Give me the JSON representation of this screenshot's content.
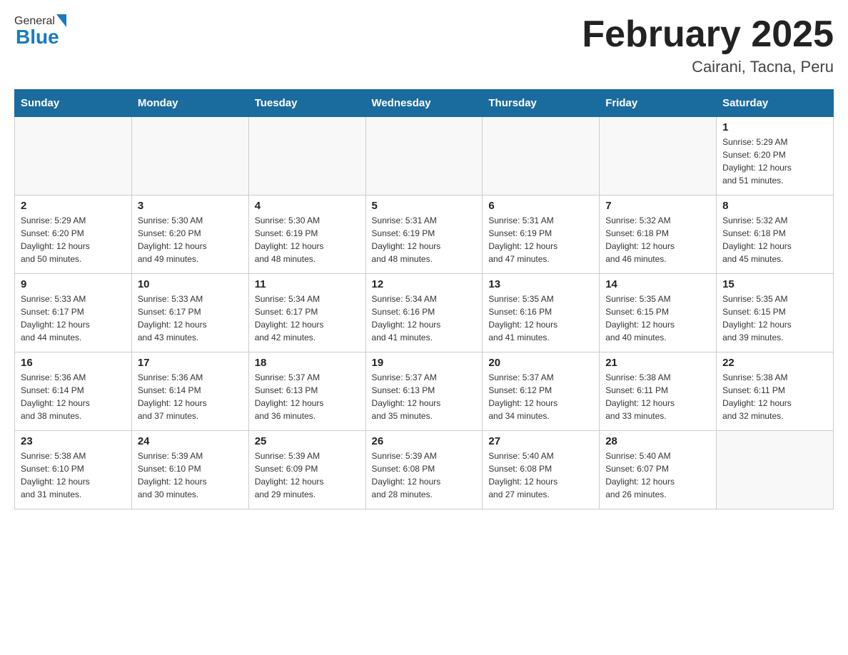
{
  "header": {
    "logo_general": "General",
    "logo_blue": "Blue",
    "title": "February 2025",
    "location": "Cairani, Tacna, Peru"
  },
  "days_of_week": [
    "Sunday",
    "Monday",
    "Tuesday",
    "Wednesday",
    "Thursday",
    "Friday",
    "Saturday"
  ],
  "weeks": [
    [
      {
        "day": "",
        "info": ""
      },
      {
        "day": "",
        "info": ""
      },
      {
        "day": "",
        "info": ""
      },
      {
        "day": "",
        "info": ""
      },
      {
        "day": "",
        "info": ""
      },
      {
        "day": "",
        "info": ""
      },
      {
        "day": "1",
        "info": "Sunrise: 5:29 AM\nSunset: 6:20 PM\nDaylight: 12 hours\nand 51 minutes."
      }
    ],
    [
      {
        "day": "2",
        "info": "Sunrise: 5:29 AM\nSunset: 6:20 PM\nDaylight: 12 hours\nand 50 minutes."
      },
      {
        "day": "3",
        "info": "Sunrise: 5:30 AM\nSunset: 6:20 PM\nDaylight: 12 hours\nand 49 minutes."
      },
      {
        "day": "4",
        "info": "Sunrise: 5:30 AM\nSunset: 6:19 PM\nDaylight: 12 hours\nand 48 minutes."
      },
      {
        "day": "5",
        "info": "Sunrise: 5:31 AM\nSunset: 6:19 PM\nDaylight: 12 hours\nand 48 minutes."
      },
      {
        "day": "6",
        "info": "Sunrise: 5:31 AM\nSunset: 6:19 PM\nDaylight: 12 hours\nand 47 minutes."
      },
      {
        "day": "7",
        "info": "Sunrise: 5:32 AM\nSunset: 6:18 PM\nDaylight: 12 hours\nand 46 minutes."
      },
      {
        "day": "8",
        "info": "Sunrise: 5:32 AM\nSunset: 6:18 PM\nDaylight: 12 hours\nand 45 minutes."
      }
    ],
    [
      {
        "day": "9",
        "info": "Sunrise: 5:33 AM\nSunset: 6:17 PM\nDaylight: 12 hours\nand 44 minutes."
      },
      {
        "day": "10",
        "info": "Sunrise: 5:33 AM\nSunset: 6:17 PM\nDaylight: 12 hours\nand 43 minutes."
      },
      {
        "day": "11",
        "info": "Sunrise: 5:34 AM\nSunset: 6:17 PM\nDaylight: 12 hours\nand 42 minutes."
      },
      {
        "day": "12",
        "info": "Sunrise: 5:34 AM\nSunset: 6:16 PM\nDaylight: 12 hours\nand 41 minutes."
      },
      {
        "day": "13",
        "info": "Sunrise: 5:35 AM\nSunset: 6:16 PM\nDaylight: 12 hours\nand 41 minutes."
      },
      {
        "day": "14",
        "info": "Sunrise: 5:35 AM\nSunset: 6:15 PM\nDaylight: 12 hours\nand 40 minutes."
      },
      {
        "day": "15",
        "info": "Sunrise: 5:35 AM\nSunset: 6:15 PM\nDaylight: 12 hours\nand 39 minutes."
      }
    ],
    [
      {
        "day": "16",
        "info": "Sunrise: 5:36 AM\nSunset: 6:14 PM\nDaylight: 12 hours\nand 38 minutes."
      },
      {
        "day": "17",
        "info": "Sunrise: 5:36 AM\nSunset: 6:14 PM\nDaylight: 12 hours\nand 37 minutes."
      },
      {
        "day": "18",
        "info": "Sunrise: 5:37 AM\nSunset: 6:13 PM\nDaylight: 12 hours\nand 36 minutes."
      },
      {
        "day": "19",
        "info": "Sunrise: 5:37 AM\nSunset: 6:13 PM\nDaylight: 12 hours\nand 35 minutes."
      },
      {
        "day": "20",
        "info": "Sunrise: 5:37 AM\nSunset: 6:12 PM\nDaylight: 12 hours\nand 34 minutes."
      },
      {
        "day": "21",
        "info": "Sunrise: 5:38 AM\nSunset: 6:11 PM\nDaylight: 12 hours\nand 33 minutes."
      },
      {
        "day": "22",
        "info": "Sunrise: 5:38 AM\nSunset: 6:11 PM\nDaylight: 12 hours\nand 32 minutes."
      }
    ],
    [
      {
        "day": "23",
        "info": "Sunrise: 5:38 AM\nSunset: 6:10 PM\nDaylight: 12 hours\nand 31 minutes."
      },
      {
        "day": "24",
        "info": "Sunrise: 5:39 AM\nSunset: 6:10 PM\nDaylight: 12 hours\nand 30 minutes."
      },
      {
        "day": "25",
        "info": "Sunrise: 5:39 AM\nSunset: 6:09 PM\nDaylight: 12 hours\nand 29 minutes."
      },
      {
        "day": "26",
        "info": "Sunrise: 5:39 AM\nSunset: 6:08 PM\nDaylight: 12 hours\nand 28 minutes."
      },
      {
        "day": "27",
        "info": "Sunrise: 5:40 AM\nSunset: 6:08 PM\nDaylight: 12 hours\nand 27 minutes."
      },
      {
        "day": "28",
        "info": "Sunrise: 5:40 AM\nSunset: 6:07 PM\nDaylight: 12 hours\nand 26 minutes."
      },
      {
        "day": "",
        "info": ""
      }
    ]
  ]
}
